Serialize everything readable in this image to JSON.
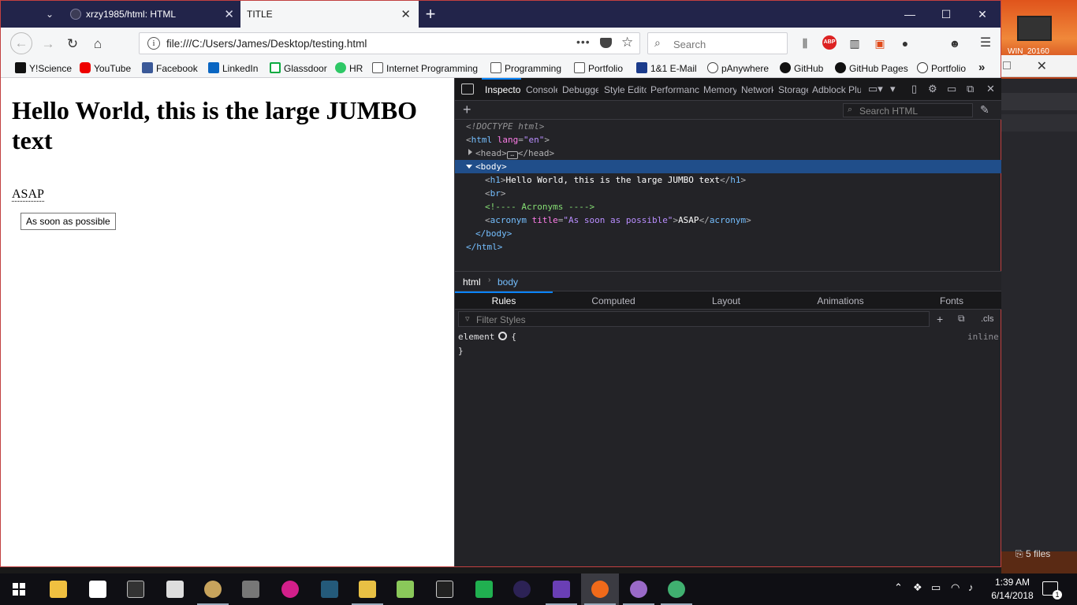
{
  "browser": {
    "tabs": [
      {
        "title": "xrzy1985/html: HTML",
        "active": false
      },
      {
        "title": "TITLE",
        "active": true
      }
    ],
    "url": "file:///C:/Users/James/Desktop/testing.html",
    "search_placeholder": "Search",
    "page_actions": "•••",
    "abp_label": "ABP",
    "accent": "#0a84ff"
  },
  "bookmarks": [
    {
      "label": "Y!Science",
      "icon": "yahoo-icon"
    },
    {
      "label": "YouTube",
      "icon": "youtube-icon"
    },
    {
      "label": "Facebook",
      "icon": "facebook-icon"
    },
    {
      "label": "LinkedIn",
      "icon": "linkedin-icon"
    },
    {
      "label": "Glassdoor",
      "icon": "glassdoor-icon"
    },
    {
      "label": "HR",
      "icon": "hackerrank-icon"
    },
    {
      "label": "Internet Programming",
      "icon": "folder-icon"
    },
    {
      "label": "Programming",
      "icon": "folder-icon"
    },
    {
      "label": "Portfolio",
      "icon": "folder-icon"
    },
    {
      "label": "1&1 E-Mail",
      "icon": "mail-icon"
    },
    {
      "label": "pAnywhere",
      "icon": "python-icon"
    },
    {
      "label": "GitHub",
      "icon": "github-icon"
    },
    {
      "label": "GitHub Pages",
      "icon": "github-icon"
    },
    {
      "label": "Portfolio",
      "icon": "globe-icon"
    }
  ],
  "page": {
    "heading": "Hello World, this is the large JUMBO text",
    "acronym": "ASAP",
    "tooltip": "As soon as possible"
  },
  "devtools": {
    "tabs": [
      "Inspector",
      "Console",
      "Debugger",
      "Style Editor",
      "Performance",
      "Memory",
      "Network",
      "Storage",
      "Adblock Plus"
    ],
    "search_placeholder": "Search HTML",
    "markup": {
      "doctype": "<!DOCTYPE html>",
      "html_tag": "html",
      "lang_attr": "lang",
      "lang_val": "\"en\"",
      "head_open": "<head>",
      "head_close": "</head>",
      "body_open": "<body>",
      "h1_text": "Hello World, this is the large JUMBO text",
      "comment": "<!---- Acronyms ---->",
      "title_attr": "title",
      "title_val": "\"As soon as possible\"",
      "acronym_text": "ASAP",
      "body_close": "</body>",
      "html_close": "</html>"
    },
    "breadcrumbs": [
      "html",
      "body"
    ],
    "panel_tabs": [
      "Rules",
      "Computed",
      "Layout",
      "Animations",
      "Fonts"
    ],
    "filter_placeholder": "Filter Styles",
    "cls_label": ".cls",
    "rule_selector": "element",
    "rule_open": "{",
    "rule_close": "}",
    "rule_source": "inline"
  },
  "desktop": {
    "thumbnail_label": "WIN_20160",
    "files_label": "5 files"
  },
  "taskbar": {
    "time": "1:39 AM",
    "date": "6/14/2018",
    "notifications": "1"
  }
}
